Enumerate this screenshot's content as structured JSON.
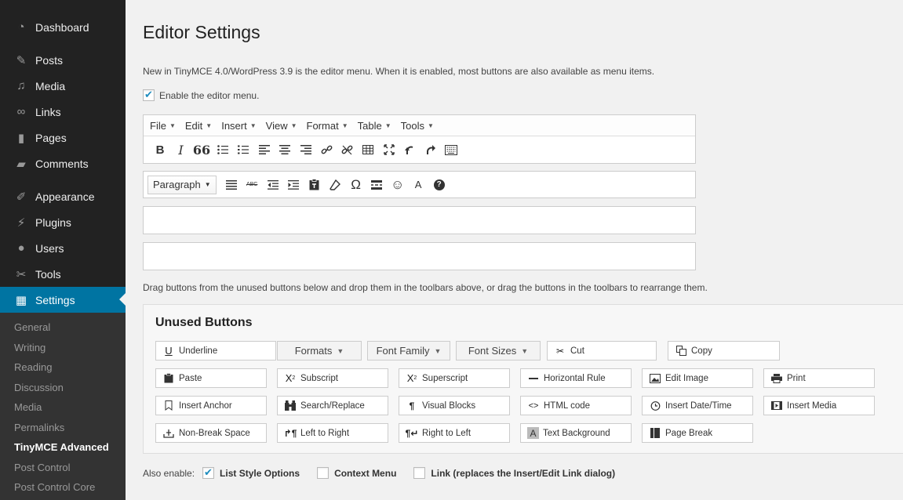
{
  "sidebar": {
    "items": [
      {
        "label": "Dashboard",
        "icon": "dashboard-icon"
      },
      {
        "label": "Posts",
        "icon": "pin-icon"
      },
      {
        "label": "Media",
        "icon": "media-icon"
      },
      {
        "label": "Links",
        "icon": "link-icon"
      },
      {
        "label": "Pages",
        "icon": "pages-icon"
      },
      {
        "label": "Comments",
        "icon": "comment-icon"
      },
      {
        "label": "Appearance",
        "icon": "brush-icon"
      },
      {
        "label": "Plugins",
        "icon": "plug-icon"
      },
      {
        "label": "Users",
        "icon": "users-icon"
      },
      {
        "label": "Tools",
        "icon": "wrench-icon"
      },
      {
        "label": "Settings",
        "icon": "settings-icon"
      }
    ],
    "submenu": [
      "General",
      "Writing",
      "Reading",
      "Discussion",
      "Media",
      "Permalinks",
      "TinyMCE Advanced",
      "Post Control",
      "Post Control Core"
    ]
  },
  "page": {
    "title": "Editor Settings",
    "intro": "New in TinyMCE 4.0/WordPress 3.9 is the editor menu. When it is enabled, most buttons are also available as menu items.",
    "enable_menu_label": "Enable the editor menu.",
    "drag_hint": "Drag buttons from the unused buttons below and drop them in the toolbars above, or drag the buttons in the toolbars to rearrange them."
  },
  "menubar": [
    "File",
    "Edit",
    "Insert",
    "View",
    "Format",
    "Table",
    "Tools"
  ],
  "toolbar2": {
    "format_select": "Paragraph"
  },
  "toolbar1_glyphs": {
    "bold": "B",
    "italic": "I",
    "quote": "66"
  },
  "toolbar2_glyphs": {
    "strike": "ABC",
    "omega": "Ω",
    "textcolor": "A",
    "help": "?"
  },
  "unused": {
    "title": "Unused Buttons",
    "buttons": {
      "underline": "Underline",
      "formats": "Formats",
      "fontfamily": "Font Family",
      "fontsizes": "Font Sizes",
      "cut": "Cut",
      "copy": "Copy",
      "paste": "Paste",
      "subscript": "Subscript",
      "superscript": "Superscript",
      "hr": "Horizontal Rule",
      "editimage": "Edit Image",
      "print": "Print",
      "anchor": "Insert Anchor",
      "searchreplace": "Search/Replace",
      "visualblocks": "Visual Blocks",
      "htmlcode": "HTML code",
      "datetime": "Insert Date/Time",
      "insertmedia": "Insert Media",
      "nbsp": "Non-Break Space",
      "ltr": "Left to Right",
      "rtl": "Right to Left",
      "textbg": "Text Background",
      "pagebreak": "Page Break"
    },
    "glyphs": {
      "underline": "U",
      "subscript": "X",
      "superscript": "X",
      "textbg": "A"
    }
  },
  "also": {
    "label": "Also enable:",
    "list_style": "List Style Options",
    "context_menu": "Context Menu",
    "link": "Link (replaces the Insert/Edit Link dialog)"
  }
}
